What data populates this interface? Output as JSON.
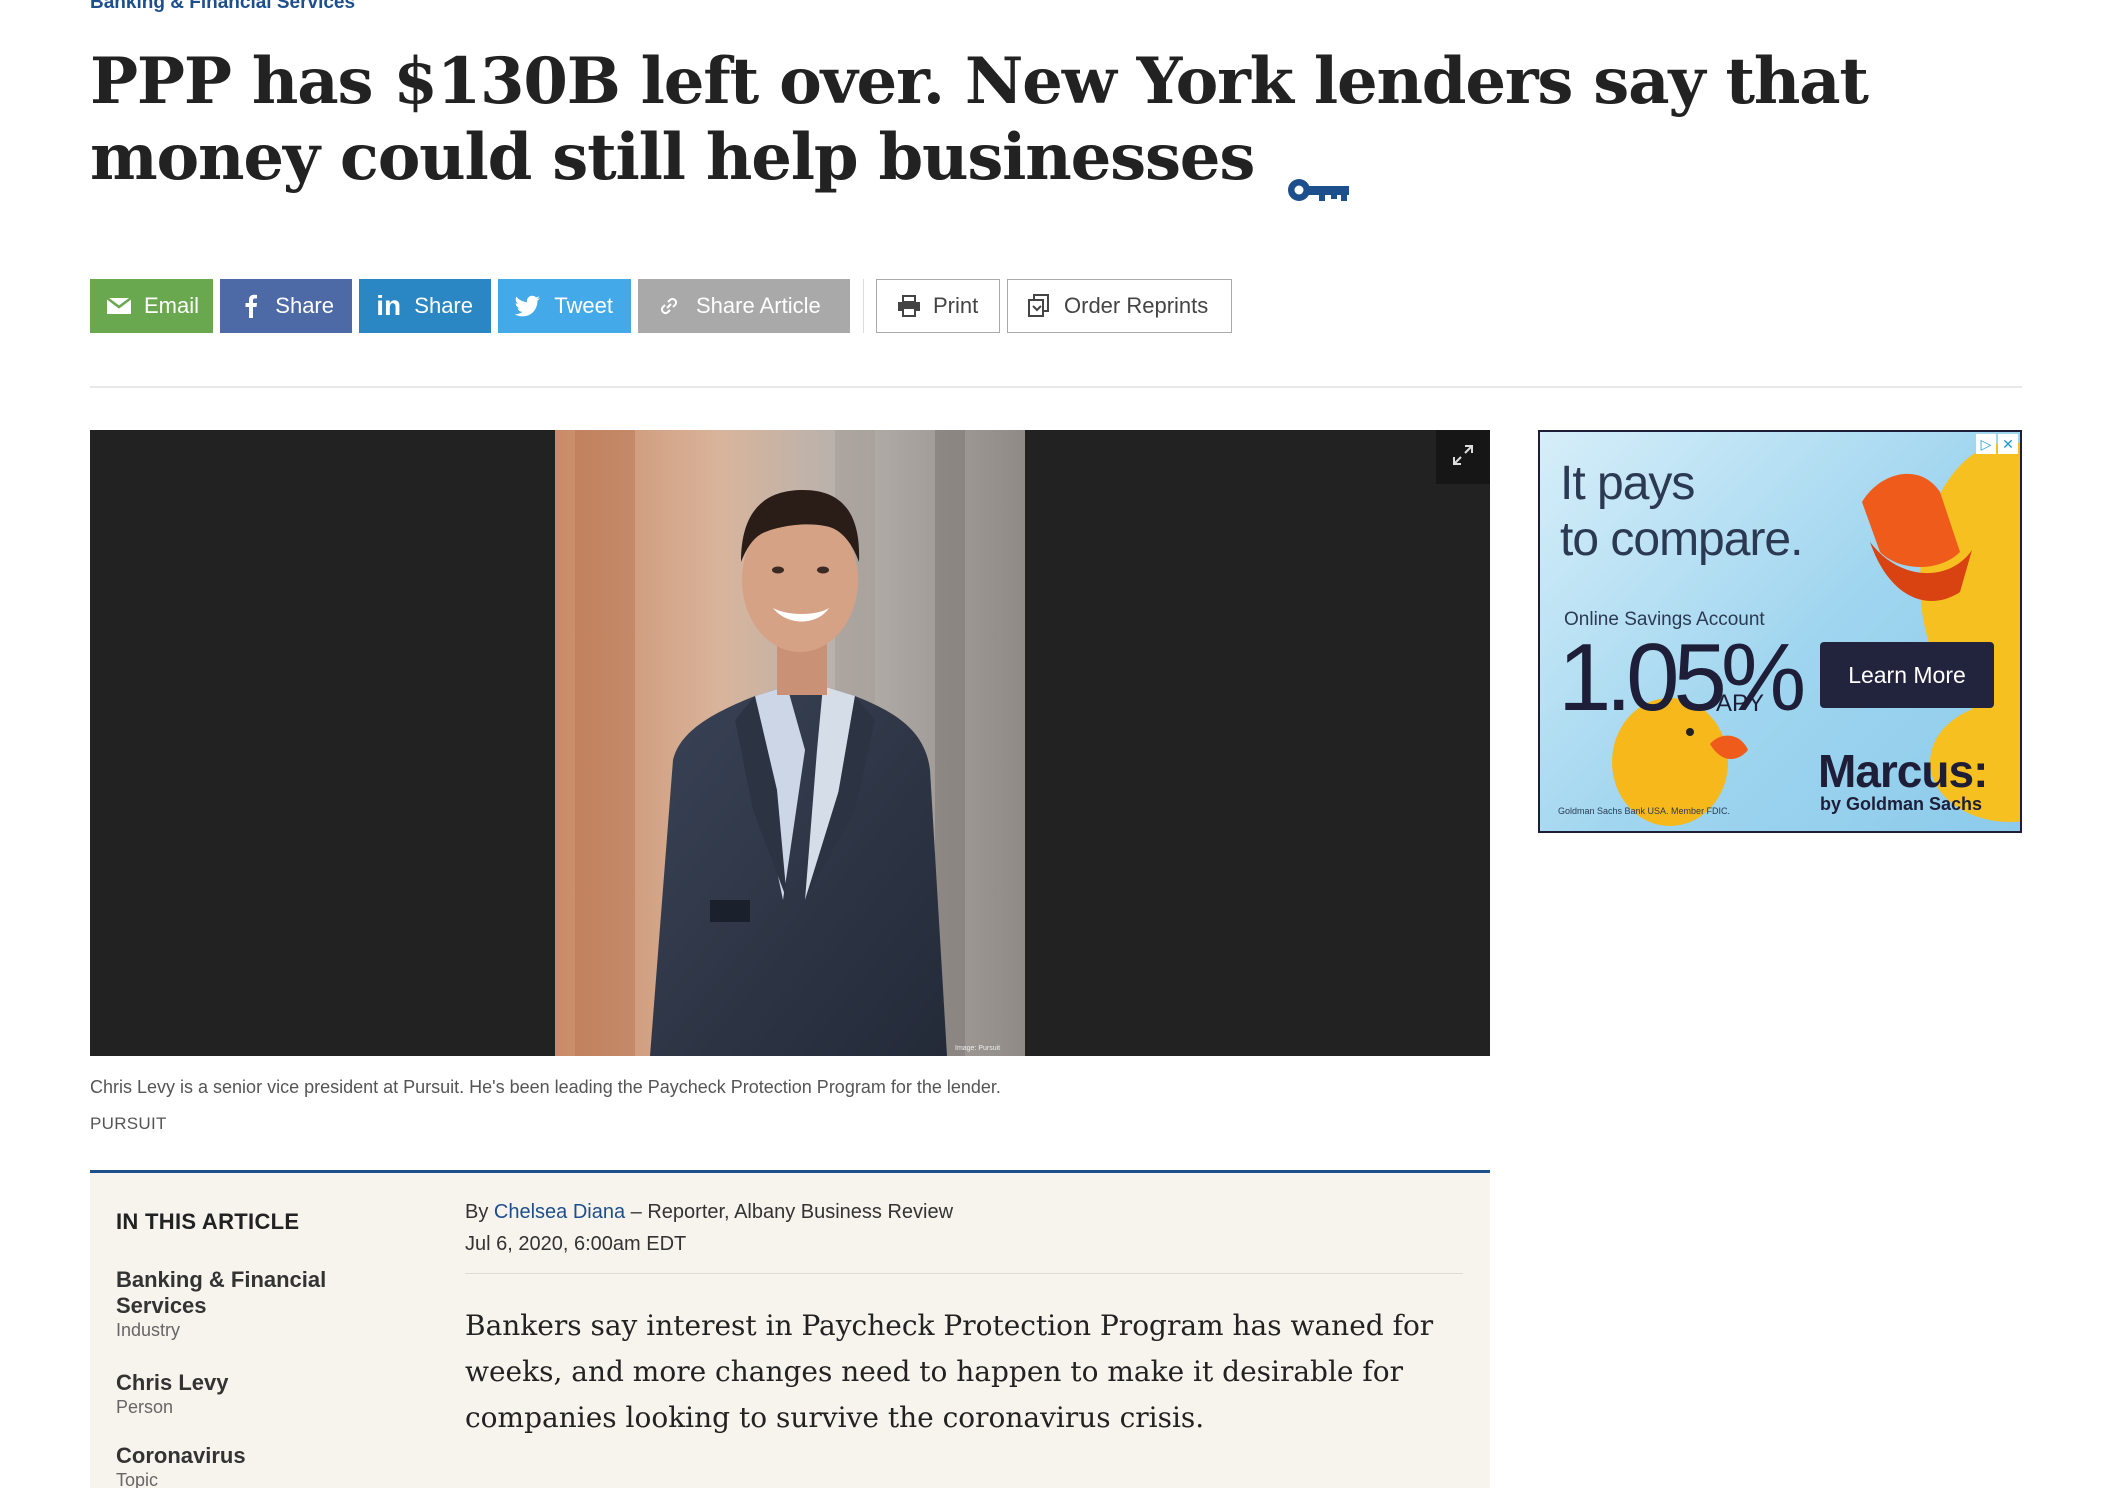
{
  "section": "Banking & Financial Services",
  "headline": "PPP has $130B left over. New York lenders say that money could still help businesses",
  "headline_icon": "key-icon",
  "share": {
    "email": "Email",
    "facebook": "Share",
    "linkedin": "Share",
    "twitter": "Tweet",
    "share_article": "Share Article",
    "print": "Print",
    "order_reprints": "Order Reprints"
  },
  "media": {
    "caption": "Chris Levy is a senior vice president at Pursuit. He's been leading the Paycheck Protection Program for the lender.",
    "credit": "PURSUIT",
    "watermark": "Image: Pursuit"
  },
  "ad": {
    "headline_line1": "It pays",
    "headline_line2": "to compare.",
    "subhead": "Online Savings Account",
    "rate": "1.05%",
    "rate_unit": "APY",
    "cta": "Learn More",
    "brand": "Marcus:",
    "brand_sub": "by Goldman Sachs",
    "fine_print": "Goldman Sachs Bank USA. Member FDIC."
  },
  "article": {
    "in_this_article_title": "IN THIS ARTICLE",
    "related": [
      {
        "title": "Banking & Financial Services",
        "kind": "Industry"
      },
      {
        "title": "Chris Levy",
        "kind": "Person"
      },
      {
        "title": "Coronavirus",
        "kind": "Topic"
      }
    ],
    "by_prefix": "By",
    "author": "Chelsea Diana",
    "author_role": "– Reporter, Albany Business Review",
    "date": "Jul 6, 2020, 6:00am EDT",
    "lede": "Bankers say interest in Paycheck Protection Program has waned for weeks, and more changes need to happen to make it desirable for companies looking to survive the coronavirus crisis."
  },
  "colors": {
    "accent": "#1d4f8c",
    "email": "#6aa84f",
    "facebook": "#4d6aa6",
    "linkedin": "#2a87c4",
    "twitter": "#43a9e8"
  }
}
